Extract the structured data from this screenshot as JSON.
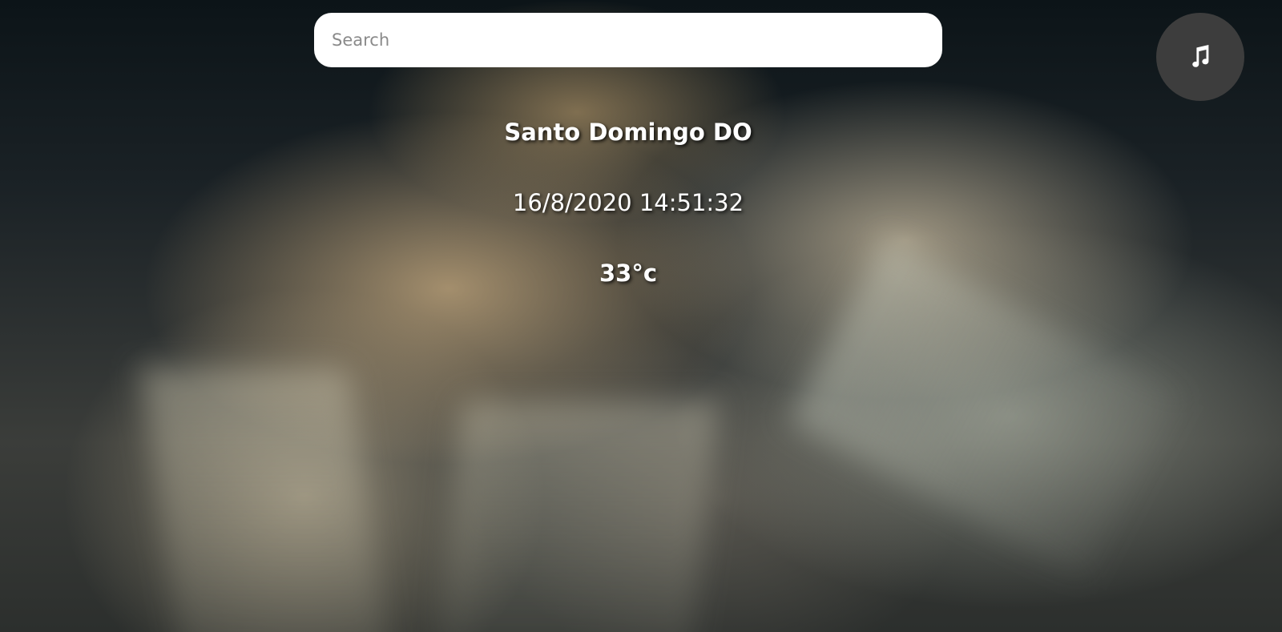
{
  "search": {
    "placeholder": "Search",
    "value": ""
  },
  "music_button": {
    "icon": "music-note-icon"
  },
  "weather": {
    "city": "Santo Domingo DO",
    "datetime": "16/8/2020 14:51:32",
    "temperature": "33°c"
  },
  "colors": {
    "search_background": "#ffffff",
    "music_button_background": "#3d3d3d",
    "text": "#ffffff"
  }
}
